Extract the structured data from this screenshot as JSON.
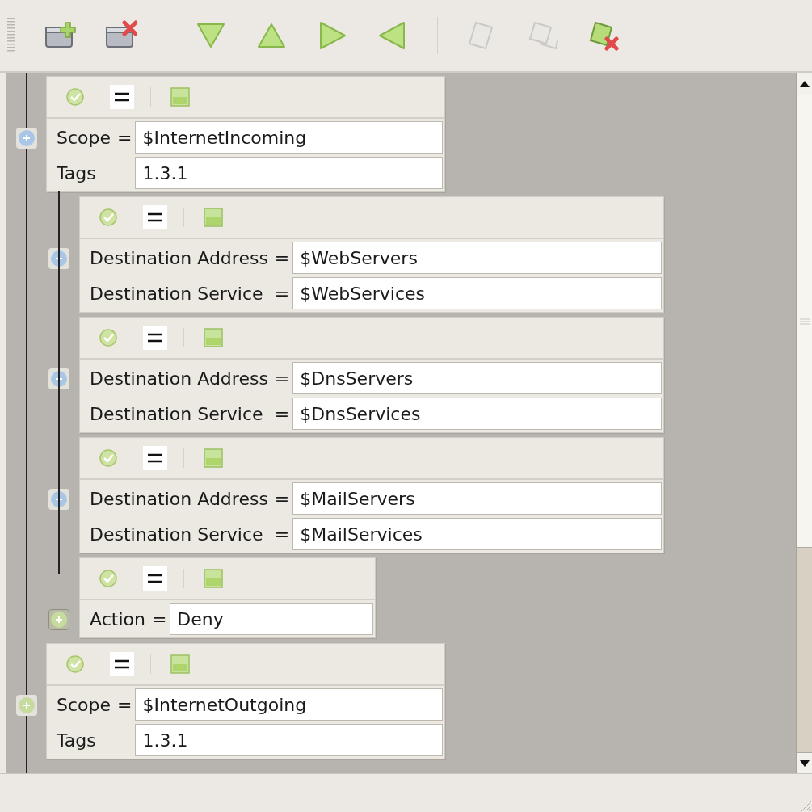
{
  "toolbar": [
    {
      "kind": "add-folder",
      "disabled": false
    },
    {
      "kind": "delete-folder",
      "disabled": false
    },
    {
      "kind": "separator"
    },
    {
      "kind": "move-down",
      "disabled": false
    },
    {
      "kind": "move-up",
      "disabled": false
    },
    {
      "kind": "move-right",
      "disabled": false
    },
    {
      "kind": "move-left",
      "disabled": false
    },
    {
      "kind": "separator"
    },
    {
      "kind": "page",
      "disabled": true
    },
    {
      "kind": "pages",
      "disabled": true
    },
    {
      "kind": "delete-page",
      "disabled": false
    }
  ],
  "rules": [
    {
      "color": "#a9c6e6",
      "selected": false,
      "fields": [
        {
          "label": "Scope",
          "operator": "=",
          "value": "$InternetIncoming"
        },
        {
          "label": "Tags",
          "value": "1.3.1"
        }
      ],
      "children": [
        {
          "color": "#a9c6e6",
          "selected": false,
          "fields": [
            {
              "label": "Destination Address",
              "operator": "=",
              "value": "$WebServers"
            },
            {
              "label": "Destination Service",
              "operator": "=",
              "value": "$WebServices"
            }
          ]
        },
        {
          "color": "#a9c6e6",
          "selected": false,
          "fields": [
            {
              "label": "Destination Address",
              "operator": "=",
              "value": "$DnsServers"
            },
            {
              "label": "Destination Service",
              "operator": "=",
              "value": "$DnsServices"
            }
          ]
        },
        {
          "color": "#a9c6e6",
          "selected": false,
          "fields": [
            {
              "label": "Destination Address",
              "operator": "=",
              "value": "$MailServers"
            },
            {
              "label": "Destination Service",
              "operator": "=",
              "value": "$MailServices"
            }
          ]
        },
        {
          "color": "#c6dc9e",
          "selected": true,
          "fields": [
            {
              "label": "Action",
              "operator": "=",
              "value": "Deny"
            }
          ]
        }
      ]
    },
    {
      "color": "#c6dc9e",
      "selected": false,
      "fields": [
        {
          "label": "Scope",
          "operator": "=",
          "value": "$InternetOutgoing"
        },
        {
          "label": "Tags",
          "value": "1.3.1"
        }
      ]
    }
  ]
}
